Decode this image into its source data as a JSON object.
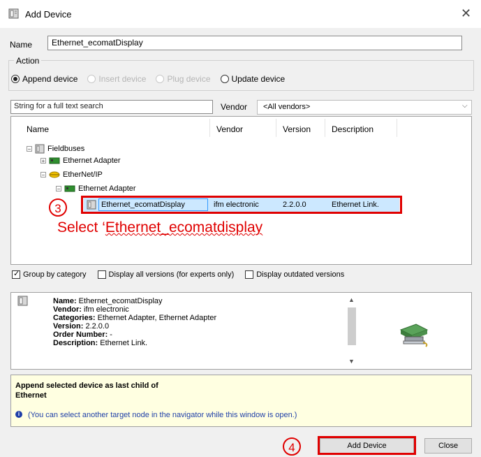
{
  "window": {
    "title": "Add Device",
    "close_icon": "close-icon"
  },
  "name_field": {
    "label": "Name",
    "value": "Ethernet_ecomatDisplay"
  },
  "action": {
    "legend": "Action",
    "options": [
      {
        "label": "Append device",
        "checked": true,
        "disabled": false
      },
      {
        "label": "Insert device",
        "checked": false,
        "disabled": true
      },
      {
        "label": "Plug device",
        "checked": false,
        "disabled": true
      },
      {
        "label": "Update device",
        "checked": false,
        "disabled": false
      }
    ]
  },
  "search": {
    "placeholder": "String for a full text search"
  },
  "vendor": {
    "label": "Vendor",
    "selected": "<All vendors>"
  },
  "tree": {
    "columns": [
      "Name",
      "Vendor",
      "Version",
      "Description"
    ],
    "items": [
      {
        "label": "Fieldbuses",
        "expander": "−"
      },
      {
        "label": "Ethernet Adapter",
        "expander": "+"
      },
      {
        "label": "EtherNet/IP",
        "expander": "−"
      },
      {
        "label": "Ethernet Adapter",
        "expander": "−"
      }
    ],
    "selected": {
      "name": "Ethernet_ecomatDisplay",
      "vendor": "ifm electronic",
      "version": "2.2.0.0",
      "description": "Ethernet Link."
    }
  },
  "annotations": {
    "step3": "3",
    "step3_text_plain": "Select ‘",
    "step3_text_squiggle": "Ethernet_ecomatdisplay",
    "step4": "4",
    "color": "#e00000"
  },
  "filters": [
    {
      "label": "Group by category",
      "checked": true
    },
    {
      "label": "Display all versions (for experts only)",
      "checked": false
    },
    {
      "label": "Display outdated versions",
      "checked": false
    }
  ],
  "info": {
    "name_key": "Name:",
    "name_val": " Ethernet_ecomatDisplay",
    "vendor_key": "Vendor:",
    "vendor_val": " ifm electronic",
    "categories_key": "Categories:",
    "categories_val": " Ethernet Adapter, Ethernet Adapter",
    "version_key": "Version:",
    "version_val": " 2.2.0.0",
    "order_key": "Order Number:",
    "order_val": " -",
    "desc_key": "Description:",
    "desc_val": " Ethernet Link."
  },
  "append": {
    "line1": "Append selected device as last child of",
    "line2": "Ethernet",
    "hint": "(You can select another target node in the navigator while this window is open.)"
  },
  "buttons": {
    "add": "Add Device",
    "close": "Close"
  }
}
